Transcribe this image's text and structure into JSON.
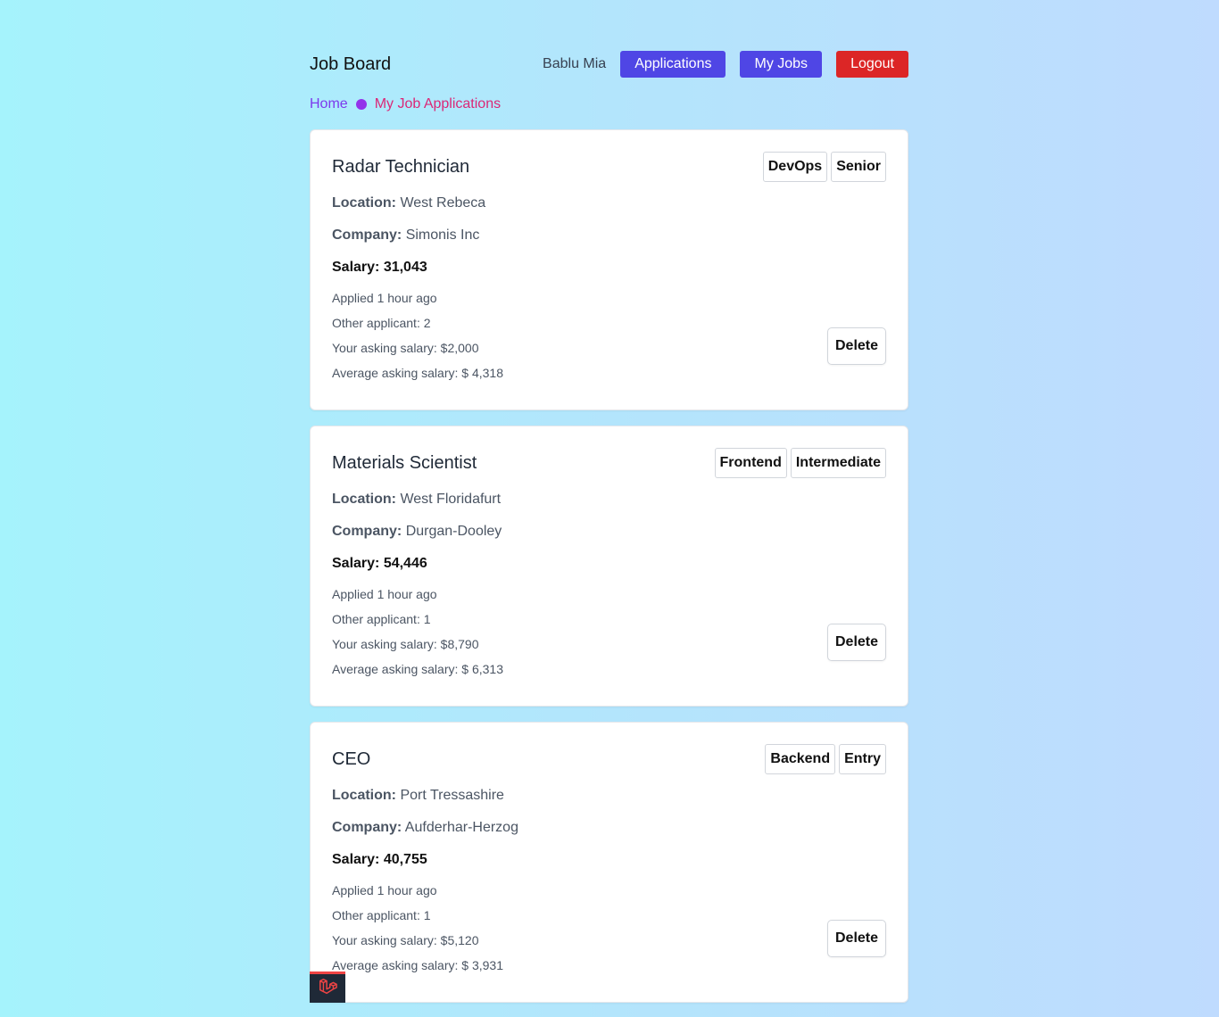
{
  "nav": {
    "brand": "Job Board",
    "user_name": "Bablu Mia",
    "applications_label": "Applications",
    "my_jobs_label": "My Jobs",
    "logout_label": "Logout"
  },
  "breadcrumb": {
    "home": "Home",
    "current": "My Job Applications"
  },
  "labels": {
    "location": "Location:",
    "company": "Company:",
    "delete": "Delete"
  },
  "applications": [
    {
      "title": "Radar Technician",
      "tags": [
        "DevOps",
        "Senior"
      ],
      "location": "West Rebeca",
      "company": "Simonis Inc",
      "salary": "Salary: 31,043",
      "applied": "Applied 1 hour ago",
      "other_applicants": "Other applicant: 2",
      "asking_salary": "Your asking salary: $2,000",
      "average_salary": "Average asking salary: $ 4,318"
    },
    {
      "title": "Materials Scientist",
      "tags": [
        "Frontend",
        "Intermediate"
      ],
      "location": "West Floridafurt",
      "company": "Durgan-Dooley",
      "salary": "Salary: 54,446",
      "applied": "Applied 1 hour ago",
      "other_applicants": "Other applicant: 1",
      "asking_salary": "Your asking salary: $8,790",
      "average_salary": "Average asking salary: $ 6,313"
    },
    {
      "title": "CEO",
      "tags": [
        "Backend",
        "Entry"
      ],
      "location": "Port Tressashire",
      "company": "Aufderhar-Herzog",
      "salary": "Salary: 40,755",
      "applied": "Applied 1 hour ago",
      "other_applicants": "Other applicant: 1",
      "asking_salary": "Your asking salary: $5,120",
      "average_salary": "Average asking salary: $ 3,931"
    }
  ],
  "colors": {
    "primary": "#4f46e5",
    "danger": "#dc2626",
    "breadcrumb_home": "#7c3aed",
    "breadcrumb_current": "#db2777"
  },
  "icons": {
    "debugbar": "laravel-logo-icon"
  }
}
